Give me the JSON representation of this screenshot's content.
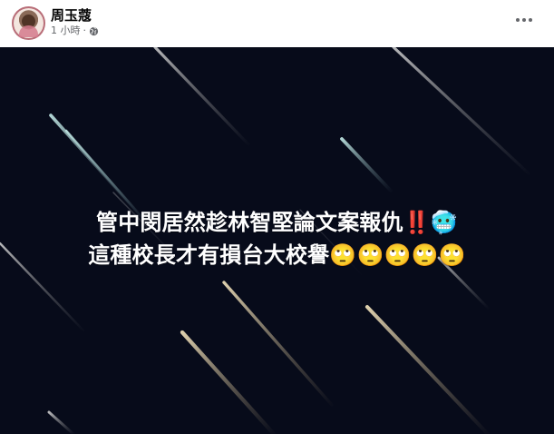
{
  "post": {
    "author": {
      "name": "周玉蔻",
      "avatar_icon": "profile-avatar"
    },
    "meta": {
      "time": "1 小時",
      "separator": "·",
      "privacy_icon": "public-globe-icon"
    },
    "more_icon": "more-options-icon"
  },
  "media": {
    "background_color": "#070b1a",
    "line1": {
      "text": "管中閔居然趁林智堅論文案報仇",
      "emojis": "‼️🥶"
    },
    "line2": {
      "text": "這種校長才有損台大校譽",
      "emojis": "🙄🙄🙄🙄🙄"
    }
  }
}
